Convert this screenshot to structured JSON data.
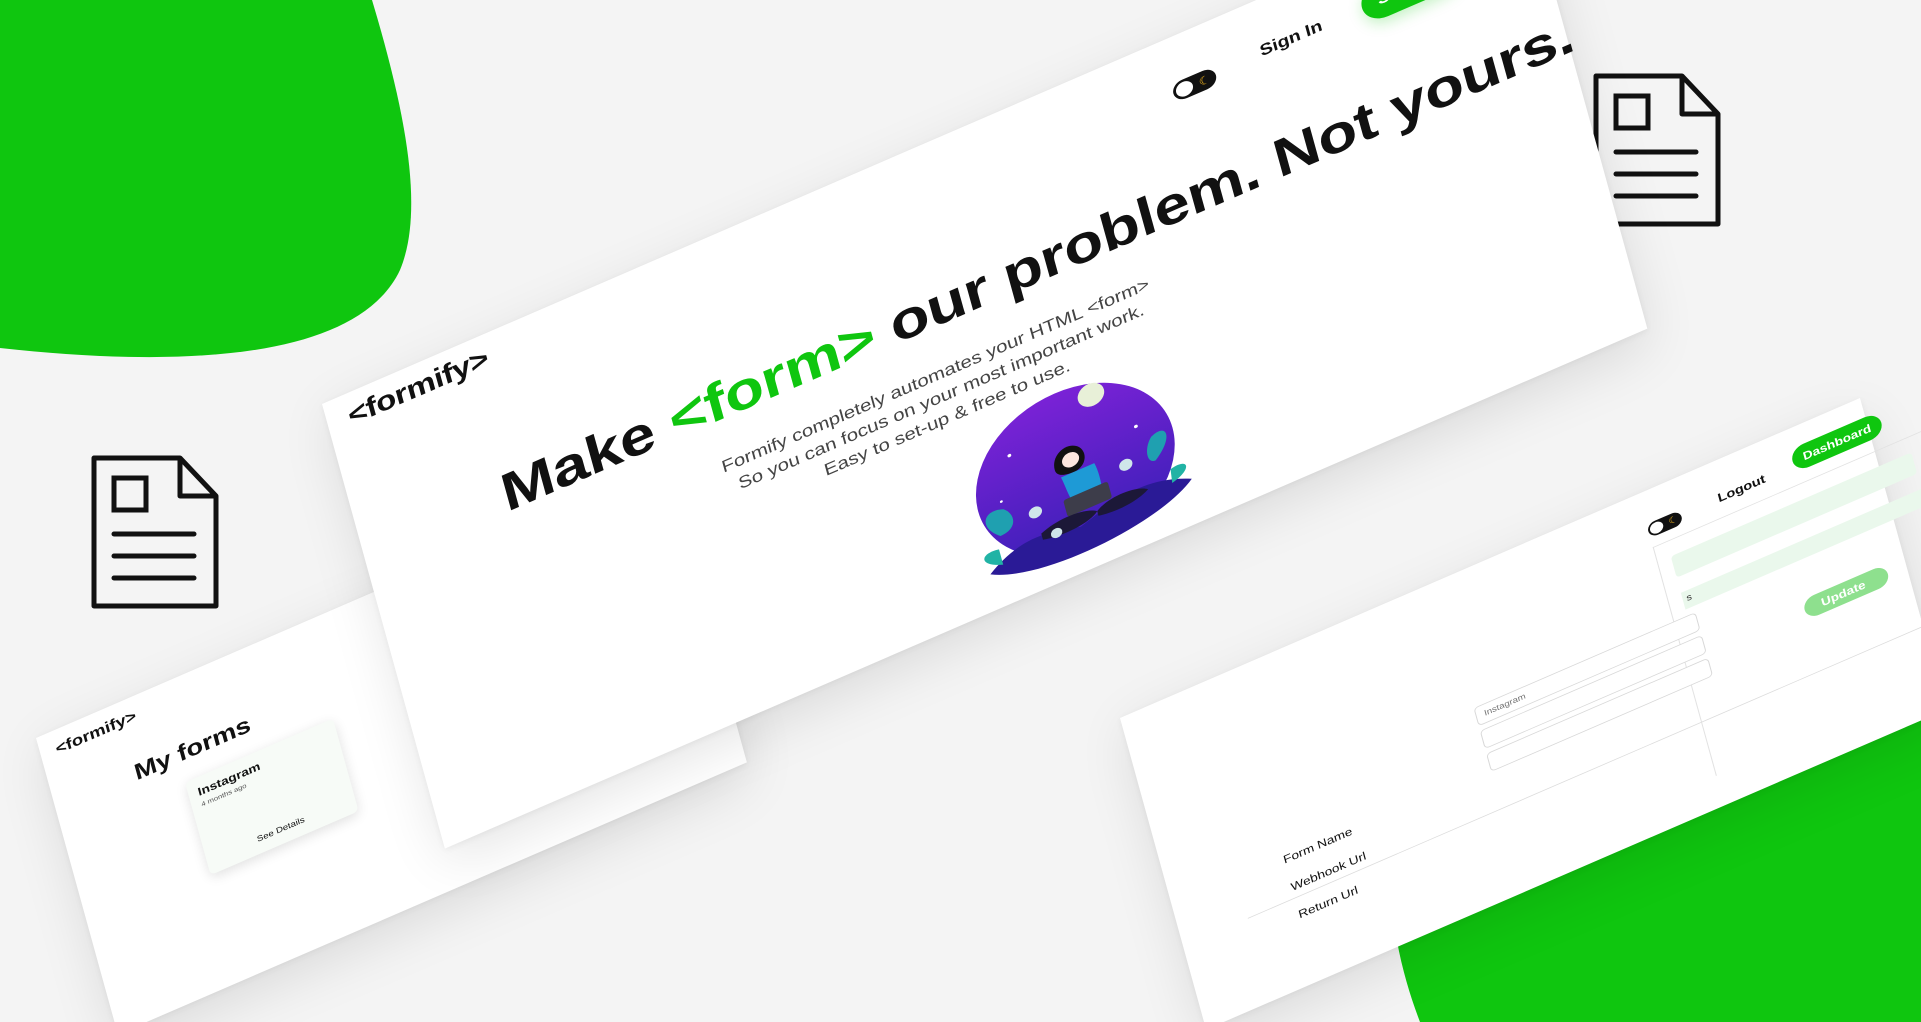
{
  "colors": {
    "brand_green": "#0fc60f",
    "background": "#f4f4f4",
    "text_dark": "#111111"
  },
  "hero": {
    "logo": "<formify>",
    "theme_toggle_icon": "moon-icon",
    "nav": {
      "signin_label": "Sign In",
      "signup_label": "Sign Up"
    },
    "headline": {
      "part1": "Make ",
      "highlight": "<form>",
      "part2": " our problem. Not yours."
    },
    "subtext": {
      "line1": "Formify completely automates your HTML <form>",
      "line2": "So you can focus on your most important work.",
      "line3": "Easy to set-up & free to use."
    }
  },
  "dashboard": {
    "logo": "<formify>",
    "title": "My forms",
    "cards": [
      {
        "name": "Instagram",
        "time": "4 months ago",
        "details_label": "See Details"
      }
    ]
  },
  "settings": {
    "nav": {
      "logout_label": "Logout",
      "dashboard_label": "Dashboard"
    },
    "form_fields": [
      {
        "label": "Form Name",
        "placeholder": "Instagram"
      },
      {
        "label": "Webhook Url",
        "placeholder": ""
      },
      {
        "label": "Return Url",
        "placeholder": ""
      }
    ],
    "update_label": "Update",
    "partial_text": "s"
  },
  "icons": [
    "document-icon",
    "document-icon",
    "moon-icon"
  ]
}
